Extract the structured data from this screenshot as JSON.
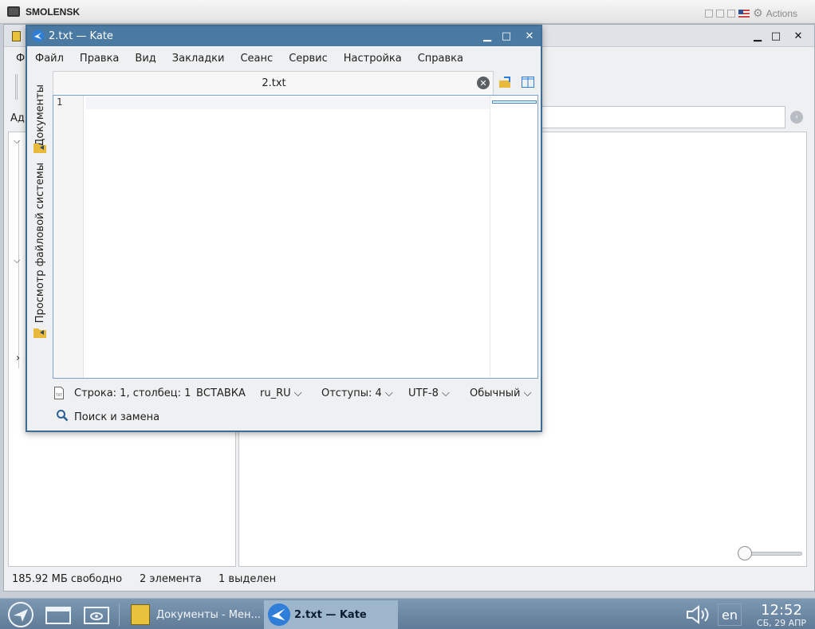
{
  "vm": {
    "title": "SMOLENSK",
    "actions_label": "Actions"
  },
  "dolphin": {
    "menu_partial": "Ф",
    "address_partial": "Ад",
    "status": {
      "free": "185.92 МБ свободно",
      "count": "2 элемента",
      "selected": "1 выделен"
    }
  },
  "kate": {
    "title": "2.txt  — Kate",
    "menu": [
      "Файл",
      "Правка",
      "Вид",
      "Закладки",
      "Сеанс",
      "Сервис",
      "Настройка",
      "Справка"
    ],
    "side_tabs": {
      "documents": "Документы",
      "filesystem": "Просмотр файловой системы"
    },
    "tab": {
      "label": "2.txt"
    },
    "editor": {
      "line_numbers": [
        "1"
      ]
    },
    "status": {
      "position": "Строка: 1, столбец: 1",
      "mode": "ВСТАВКА",
      "dictionary": "ru_RU",
      "indent": "Отступы: 4",
      "encoding": "UTF-8",
      "highlight": "Обычный"
    },
    "search_label": "Поиск и замена"
  },
  "taskbar": {
    "tasks": [
      {
        "label": "Документы - Мен...",
        "active": false
      },
      {
        "label": "2.txt  — Kate",
        "active": true
      }
    ],
    "language": "en",
    "clock_time": "12:52",
    "clock_date": "СБ, 29 АПР"
  },
  "colors": {
    "kate_titlebar": "#4a79a1",
    "taskbar": "#6e89a5",
    "active_task": "#9eb6cc",
    "editor_border": "#7aa3c8"
  }
}
